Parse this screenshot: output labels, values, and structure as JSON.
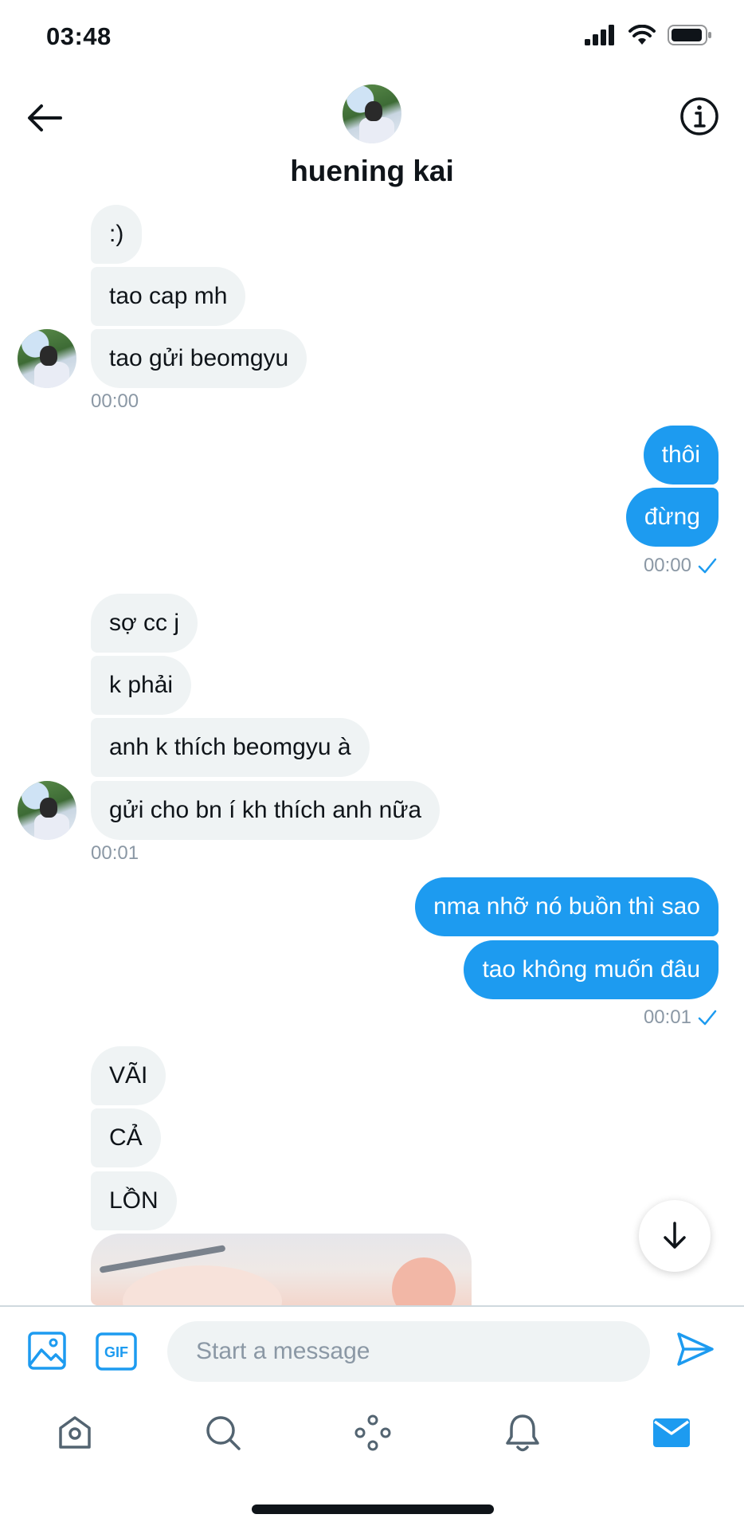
{
  "status_bar": {
    "time": "03:48"
  },
  "header": {
    "title": "huening kai",
    "back_icon": "arrow-left-icon",
    "info_icon": "info-icon"
  },
  "messages": {
    "group1": [
      "",
      ":)",
      "tao cap mh",
      "tao gửi beomgyu"
    ],
    "group1_time": "00:00",
    "group2": [
      "thôi",
      "đừng"
    ],
    "group2_time": "00:00",
    "group3": [
      "sợ cc j",
      "k phải",
      "anh k thích beomgyu à",
      "gửi cho bn í kh thích anh nữa"
    ],
    "group3_time": "00:01",
    "group4": [
      "nma nhỡ nó buồn thì sao",
      "tao không muốn đâu"
    ],
    "group4_time": "00:01",
    "group5": [
      "VÃI",
      "CẢ",
      "LỒN"
    ]
  },
  "composer": {
    "placeholder": "Start a message",
    "gif_label": "GIF"
  },
  "tabbar": {
    "items": [
      "home-icon",
      "search-icon",
      "spaces-icon",
      "notifications-icon",
      "messages-icon"
    ]
  },
  "colors": {
    "accent": "#1d9bf0",
    "bubble_in": "#eff3f4",
    "muted": "#8b98a5"
  }
}
